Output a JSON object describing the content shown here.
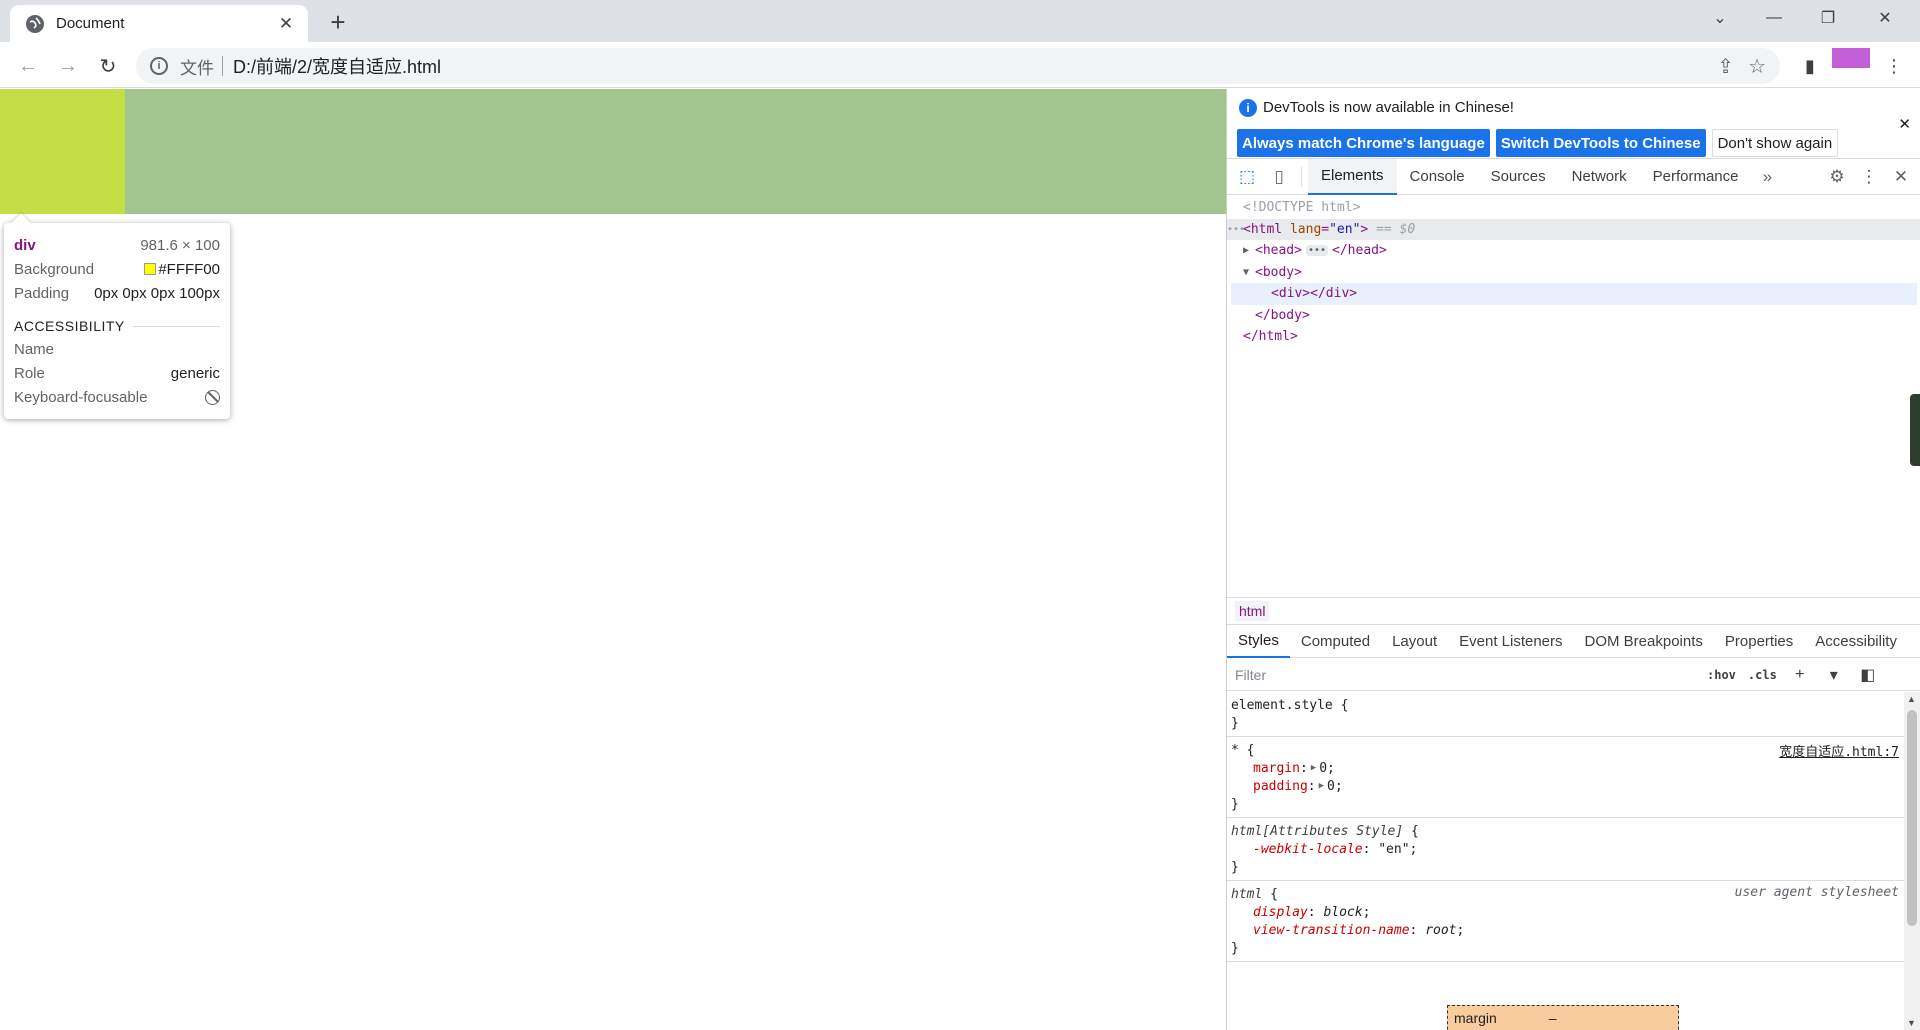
{
  "browser": {
    "tab_title": "Document",
    "tab_close": "✕",
    "new_tab": "+",
    "omnibox": {
      "chip": "文件",
      "url": "D:/前端/2/宽度自适应.html"
    },
    "extension_color": "#c25fd6"
  },
  "page": {
    "div_color": "#a2c48e",
    "padding_color": "#c5de45",
    "tooltip": {
      "tag": "div",
      "dimensions": "981.6 × 100",
      "background_label": "Background",
      "background_value": "#FFFF00",
      "padding_label": "Padding",
      "padding_value": "0px 0px 0px 100px",
      "section": "ACCESSIBILITY",
      "name_label": "Name",
      "role_label": "Role",
      "role_value": "generic",
      "focusable_label": "Keyboard-focusable"
    }
  },
  "devtools": {
    "infobar": {
      "message": "DevTools is now available in Chinese!",
      "btn_match": "Always match Chrome's language",
      "btn_switch": "Switch DevTools to Chinese",
      "btn_dismiss": "Don't show again"
    },
    "tabs": [
      "Elements",
      "Console",
      "Sources",
      "Network",
      "Performance"
    ],
    "dom": {
      "doctype": "<!DOCTYPE html>",
      "html_open": "<html",
      "html_attr": "lang",
      "html_attr_val": "\"en\"",
      "html_close_bracket": ">",
      "eq_marker": "== $0",
      "head_open": "<head>",
      "head_close": "</head>",
      "body_open": "<body>",
      "div": "<div></div>",
      "body_close": "</body>",
      "html_close": "</html>"
    },
    "breadcrumb": "html",
    "sub_tabs": [
      "Styles",
      "Computed",
      "Layout",
      "Event Listeners",
      "DOM Breakpoints",
      "Properties",
      "Accessibility"
    ],
    "filter_placeholder": "Filter",
    "hov": ":hov",
    "cls": ".cls",
    "rules": {
      "r1_selector": "element.style",
      "r2_selector": "*",
      "r2_source": "宽度自适应.html:7",
      "r2_p1": "margin",
      "r2_v1": "0",
      "r2_p2": "padding",
      "r2_v2": "0",
      "r3_selector": "html[Attributes Style]",
      "r3_p1": "-webkit-locale",
      "r3_v1": "\"en\"",
      "r4_selector": "html",
      "r4_source": "user agent stylesheet",
      "r4_p1": "display",
      "r4_v1": "block",
      "r4_p2": "view-transition-name",
      "r4_v2": "root"
    },
    "box_model": {
      "label": "margin",
      "value": "–"
    }
  }
}
